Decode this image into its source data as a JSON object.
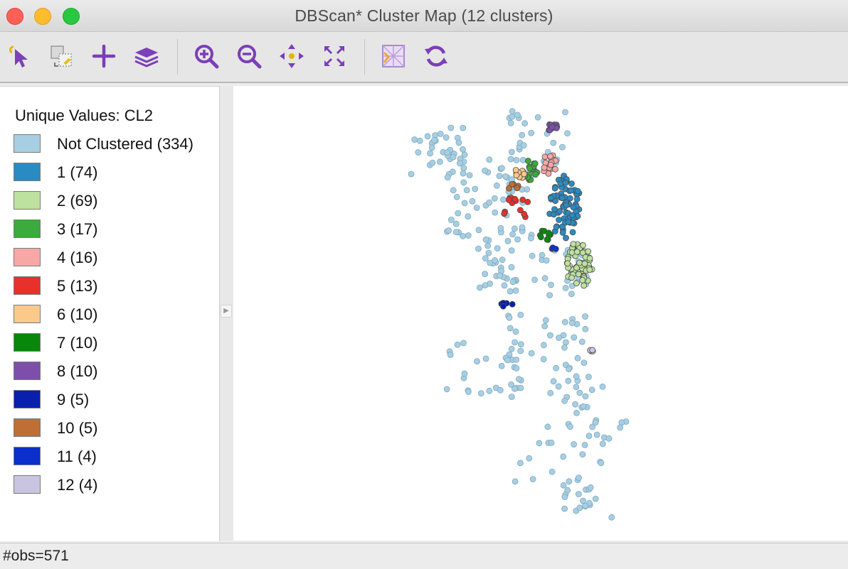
{
  "window": {
    "title": "DBScan* Cluster Map (12 clusters)"
  },
  "toolbar": {
    "tools": [
      {
        "name": "select-pointer-icon"
      },
      {
        "name": "selection-shape-icon"
      },
      {
        "name": "add-plus-icon"
      },
      {
        "name": "layers-icon"
      },
      {
        "name": "zoom-in-icon"
      },
      {
        "name": "zoom-out-icon"
      },
      {
        "name": "pan-move-icon"
      },
      {
        "name": "fit-extent-icon"
      },
      {
        "name": "basemap-icon"
      },
      {
        "name": "refresh-icon"
      }
    ],
    "accent": "#7b3fb8"
  },
  "legend": {
    "title": "Unique Values: CL2",
    "items": [
      {
        "label": "Not Clustered (334)",
        "color": "#a7cfe3"
      },
      {
        "label": "1 (74)",
        "color": "#2a8bc2"
      },
      {
        "label": "2 (69)",
        "color": "#bde19f"
      },
      {
        "label": "3 (17)",
        "color": "#3aab3c"
      },
      {
        "label": "4 (16)",
        "color": "#f7a8a6"
      },
      {
        "label": "5 (13)",
        "color": "#e8312b"
      },
      {
        "label": "6 (10)",
        "color": "#fbc98a"
      },
      {
        "label": "7 (10)",
        "color": "#07880a"
      },
      {
        "label": "8 (10)",
        "color": "#7d4fab"
      },
      {
        "label": "9 (5)",
        "color": "#0820ab"
      },
      {
        "label": "10 (5)",
        "color": "#bf6f33"
      },
      {
        "label": "11 (4)",
        "color": "#0a2fcc"
      },
      {
        "label": "12 (4)",
        "color": "#c9c5e0"
      }
    ]
  },
  "status": {
    "text": "#obs=571"
  }
}
